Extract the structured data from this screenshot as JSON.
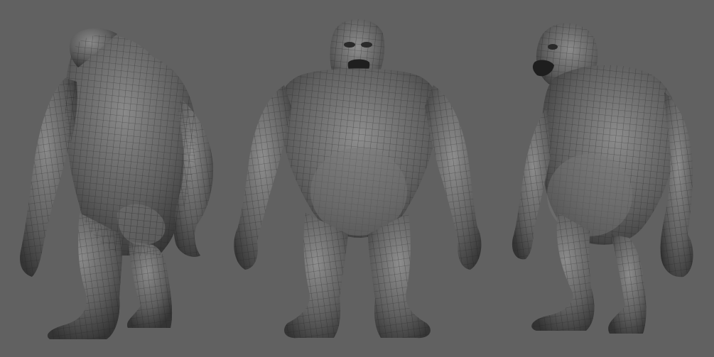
{
  "scene": {
    "background_color": "#616161",
    "mesh_color_base": "#5a5a5a",
    "mesh_color_light": "#8c8c8c",
    "mesh_color_dark": "#2f2f2f",
    "wire_color": "#222222",
    "views": [
      {
        "name": "back-three-quarter"
      },
      {
        "name": "front"
      },
      {
        "name": "side-three-quarter"
      }
    ]
  }
}
